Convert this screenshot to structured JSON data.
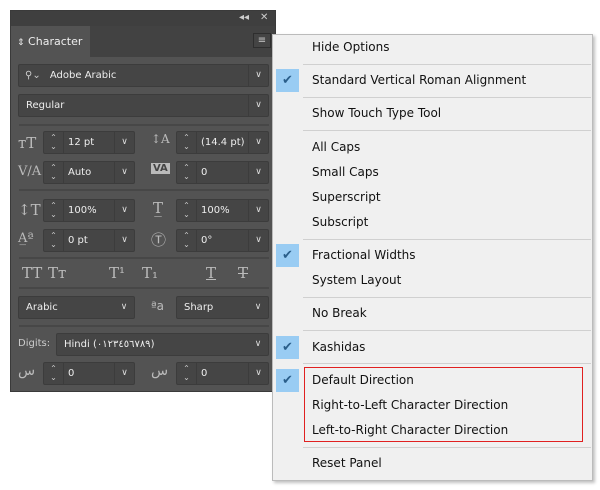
{
  "panel": {
    "title": "Character",
    "font_family": "Adobe Arabic",
    "font_style": "Regular",
    "font_size": "12 pt",
    "leading": "(14.4 pt)",
    "kerning": "Auto",
    "tracking": "0",
    "vertical_scale": "100%",
    "horizontal_scale": "100%",
    "baseline_shift": "0 pt",
    "rotation": "0°",
    "language": "Arabic",
    "antialias": "Sharp",
    "digits_label": "Digits:",
    "digits_value": "Hindi (٠١٢٣٤٥٦٧٨٩)",
    "insert_space_1": "0",
    "insert_space_2": "0",
    "caps": [
      "TT",
      "Tт",
      "T¹",
      "T₁",
      "T",
      "T"
    ]
  },
  "menu": {
    "items": [
      {
        "label": "Hide Options",
        "checked": false
      },
      {
        "label": "Standard Vertical Roman Alignment",
        "checked": true
      },
      {
        "label": "Show Touch Type Tool",
        "checked": false
      },
      {
        "label": "All Caps",
        "checked": false
      },
      {
        "label": "Small Caps",
        "checked": false
      },
      {
        "label": "Superscript",
        "checked": false
      },
      {
        "label": "Subscript",
        "checked": false
      },
      {
        "label": "Fractional Widths",
        "checked": true
      },
      {
        "label": "System Layout",
        "checked": false
      },
      {
        "label": "No Break",
        "checked": false
      },
      {
        "label": "Kashidas",
        "checked": true
      },
      {
        "label": "Default Direction",
        "checked": true
      },
      {
        "label": "Right-to-Left Character Direction",
        "checked": false
      },
      {
        "label": "Left-to-Right Character Direction",
        "checked": false
      },
      {
        "label": "Reset Panel",
        "checked": false
      }
    ]
  },
  "colors": {
    "highlight_box": "#e02020",
    "check_bg": "#99ccf3"
  }
}
